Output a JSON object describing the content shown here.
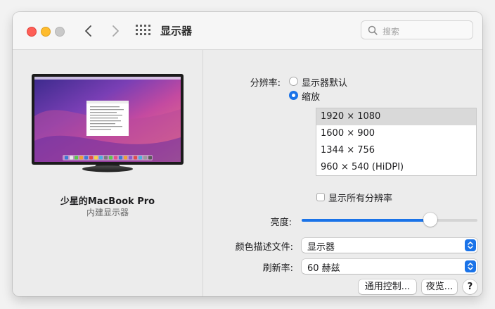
{
  "window": {
    "title": "显示器",
    "search_placeholder": "搜索",
    "traffic_lights": {
      "close": "#fe5f57",
      "minimize": "#febc2e",
      "zoom": "#c9c9c9"
    },
    "icons": {
      "back": "chevron-left-icon",
      "forward": "chevron-right-icon",
      "show_all": "grid-icon",
      "search": "magnifier-icon"
    }
  },
  "device": {
    "name": "少星的MacBook Pro",
    "subtitle": "内建显示器"
  },
  "resolution": {
    "label": "分辨率:",
    "options": [
      {
        "label": "显示器默认",
        "selected": false
      },
      {
        "label": "缩放",
        "selected": true
      }
    ],
    "list": [
      {
        "label": "1920 × 1080",
        "selected": true
      },
      {
        "label": "1600 × 900",
        "selected": false
      },
      {
        "label": "1344 × 756",
        "selected": false
      },
      {
        "label": "960 × 540 (HiDPI)",
        "selected": false
      }
    ],
    "show_all_label": "显示所有分辨率",
    "show_all_checked": false
  },
  "brightness": {
    "label": "亮度:",
    "value": 0.73
  },
  "color_profile": {
    "label": "颜色描述文件:",
    "value": "显示器"
  },
  "refresh_rate": {
    "label": "刷新率:",
    "value": "60 赫兹"
  },
  "buttons": {
    "universal_control": "通用控制...",
    "night_shift": "夜览...",
    "help": "?"
  },
  "colors": {
    "accent": "#1a73e8"
  }
}
